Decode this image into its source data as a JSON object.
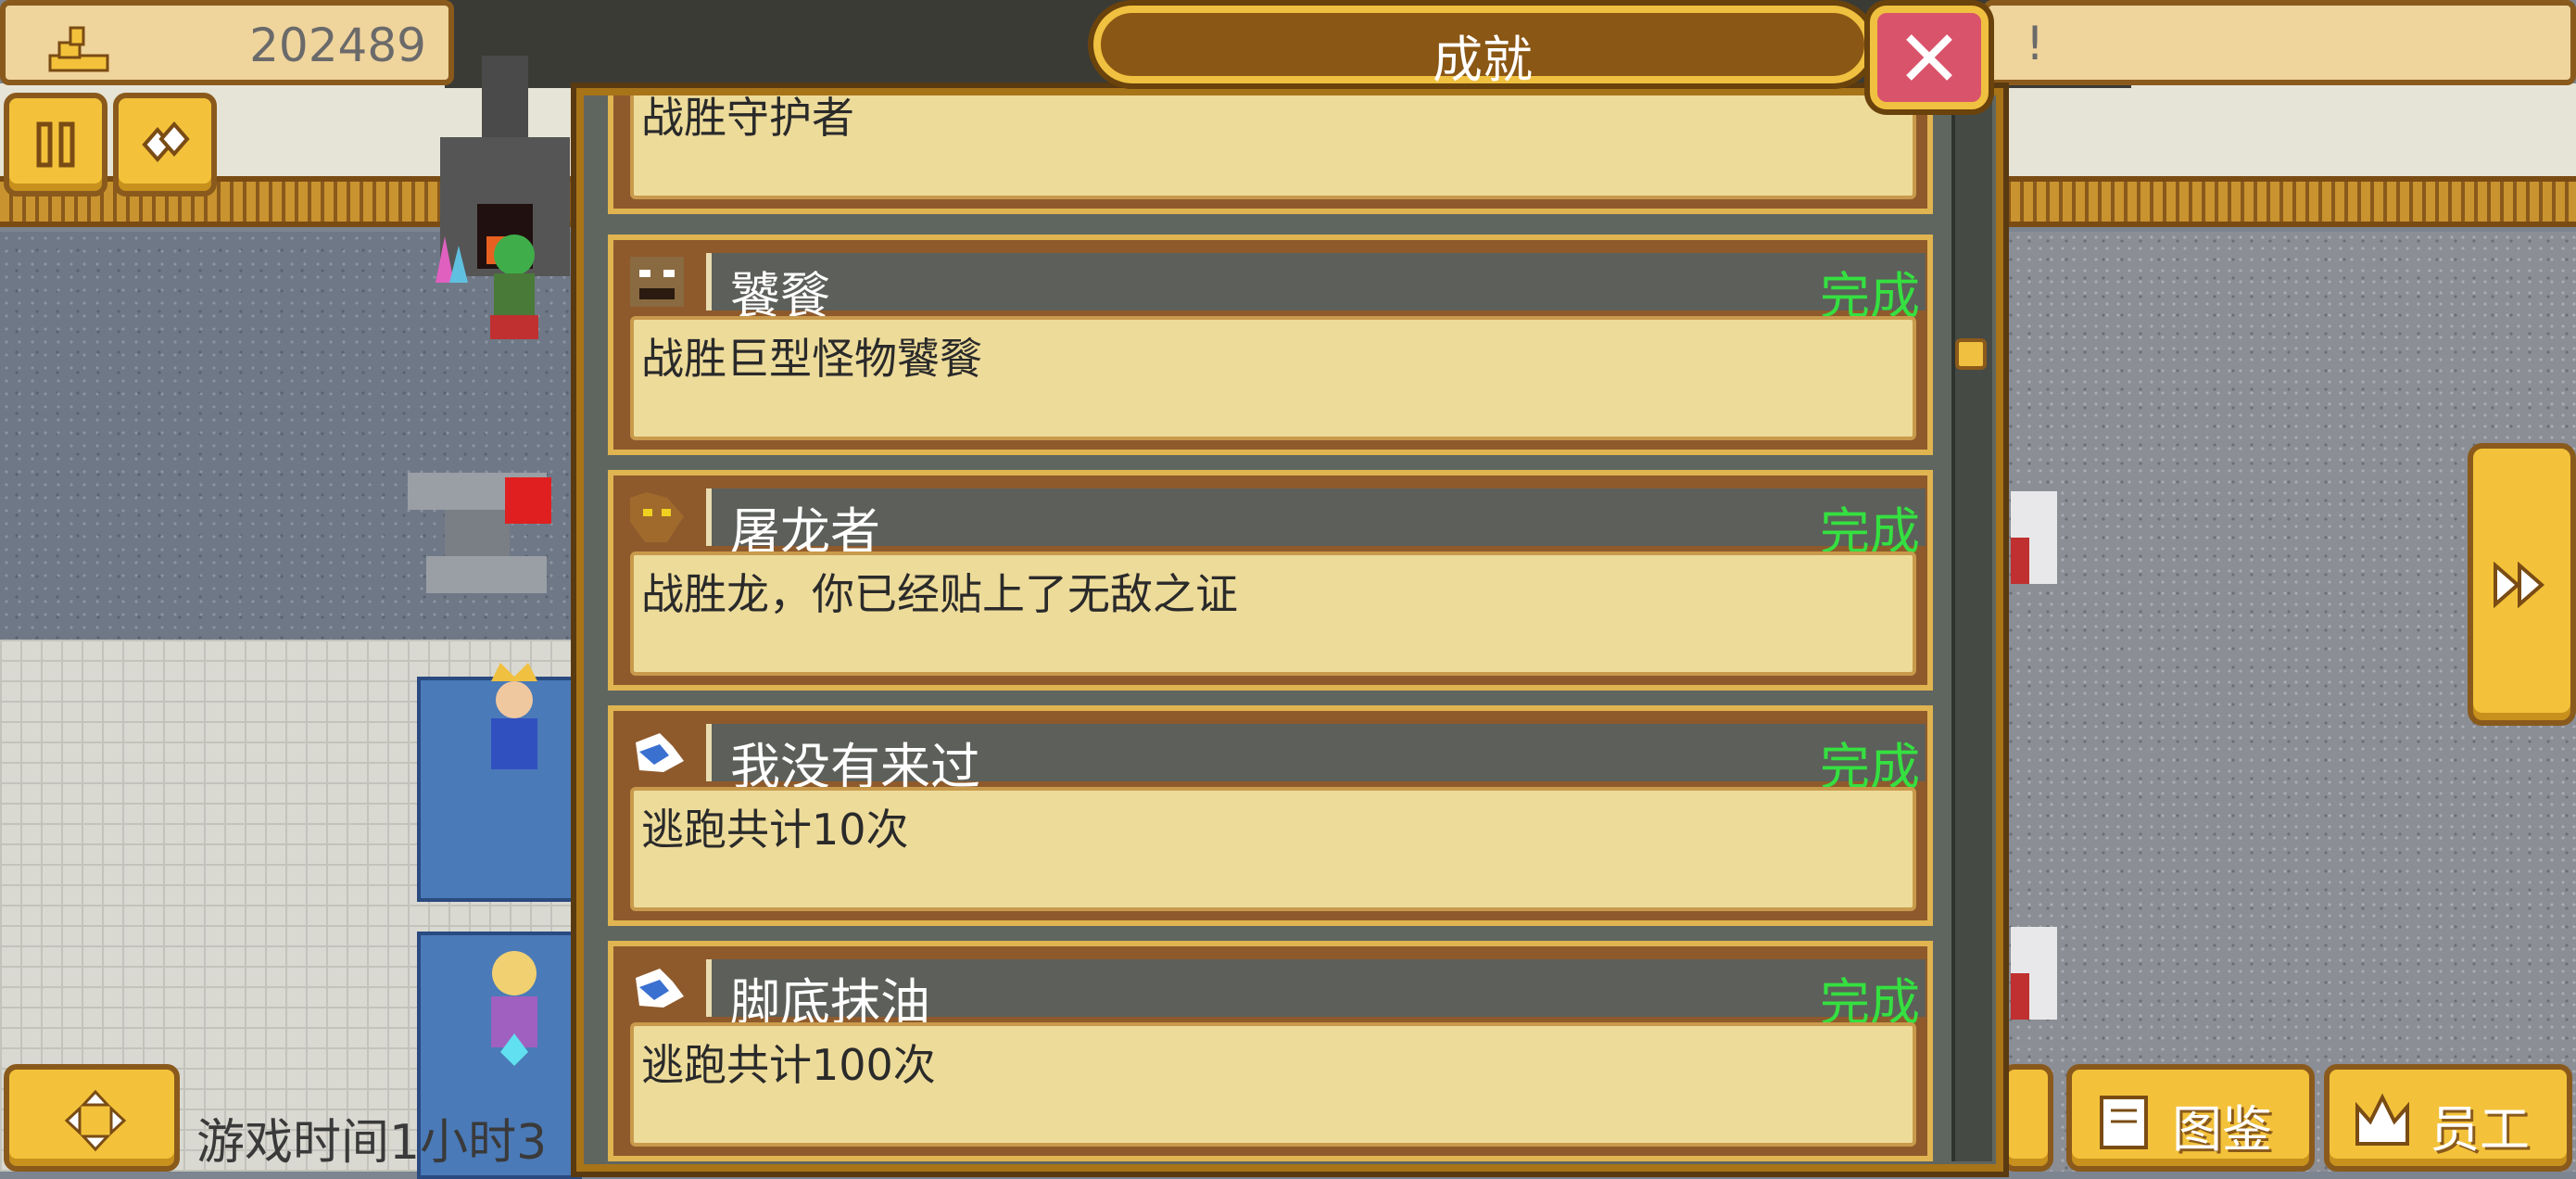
{
  "hud": {
    "money": "202489",
    "message": "!",
    "game_time": "游戏时间1小时3"
  },
  "modal": {
    "title": "成就",
    "achievements": [
      {
        "name": "",
        "desc": "战胜守护者",
        "status": "",
        "icon": "guardian-icon"
      },
      {
        "name": "饕餮",
        "desc": "战胜巨型怪物饕餮",
        "status": "完成",
        "icon": "monster-face-icon"
      },
      {
        "name": "屠龙者",
        "desc": "战胜龙，你已经贴上了无敌之证",
        "status": "完成",
        "icon": "dragon-head-icon"
      },
      {
        "name": "我没有来过",
        "desc": "逃跑共计10次",
        "status": "完成",
        "icon": "running-boot-icon"
      },
      {
        "name": "脚底抹油",
        "desc": "逃跑共计100次",
        "status": "完成",
        "icon": "running-boot-icon"
      }
    ]
  },
  "bottom_bar": {
    "encyclopedia": "图鉴",
    "staff": "员工"
  },
  "colors": {
    "complete": "#35e040",
    "gold": "#f3c23a",
    "panel": "#eddb9a"
  }
}
